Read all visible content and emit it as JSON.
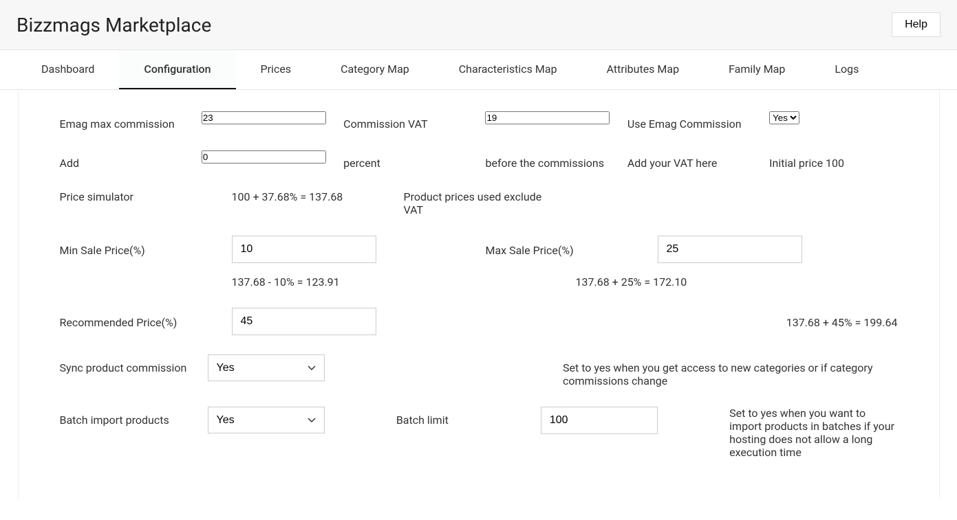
{
  "header": {
    "title": "Bizzmags Marketplace",
    "help": "Help"
  },
  "tabs": [
    {
      "label": "Dashboard",
      "active": false
    },
    {
      "label": "Configuration",
      "active": true
    },
    {
      "label": "Prices",
      "active": false
    },
    {
      "label": "Category Map",
      "active": false
    },
    {
      "label": "Characteristics Map",
      "active": false
    },
    {
      "label": "Attributes Map",
      "active": false
    },
    {
      "label": "Family Map",
      "active": false
    },
    {
      "label": "Logs",
      "active": false
    }
  ],
  "form": {
    "emag_max_commission": {
      "label": "Emag max commission",
      "value": "23"
    },
    "commission_vat": {
      "label": "Commission VAT",
      "value": "19"
    },
    "use_emag_commission": {
      "label": "Use Emag Commission",
      "value": "Yes"
    },
    "add": {
      "label": "Add",
      "value": "0",
      "unit": "percent",
      "pos": "before the commissions",
      "hint1": "Add your VAT here",
      "hint2": "Initial price 100"
    },
    "price_simulator": {
      "label": "Price simulator",
      "formula": "100 + 37.68% = 137.68",
      "note": "Product prices used exclude VAT"
    },
    "min_sale": {
      "label": "Min Sale Price(%)",
      "value": "10",
      "calc": "137.68 - 10% = 123.91"
    },
    "max_sale": {
      "label": "Max Sale Price(%)",
      "value": "25",
      "calc": "137.68 + 25% = 172.10"
    },
    "recommended": {
      "label": "Recommended Price(%)",
      "value": "45",
      "calc": "137.68 + 45% = 199.64"
    },
    "sync_commission": {
      "label": "Sync product commission",
      "value": "Yes",
      "note": "Set to yes when you get access to new categories or if category commissions change"
    },
    "batch_import": {
      "label": "Batch import products",
      "value": "Yes",
      "limit_label": "Batch limit",
      "limit_value": "100",
      "note": "Set to yes when you want to import products in batches if your hosting does not allow a long execution time"
    }
  }
}
